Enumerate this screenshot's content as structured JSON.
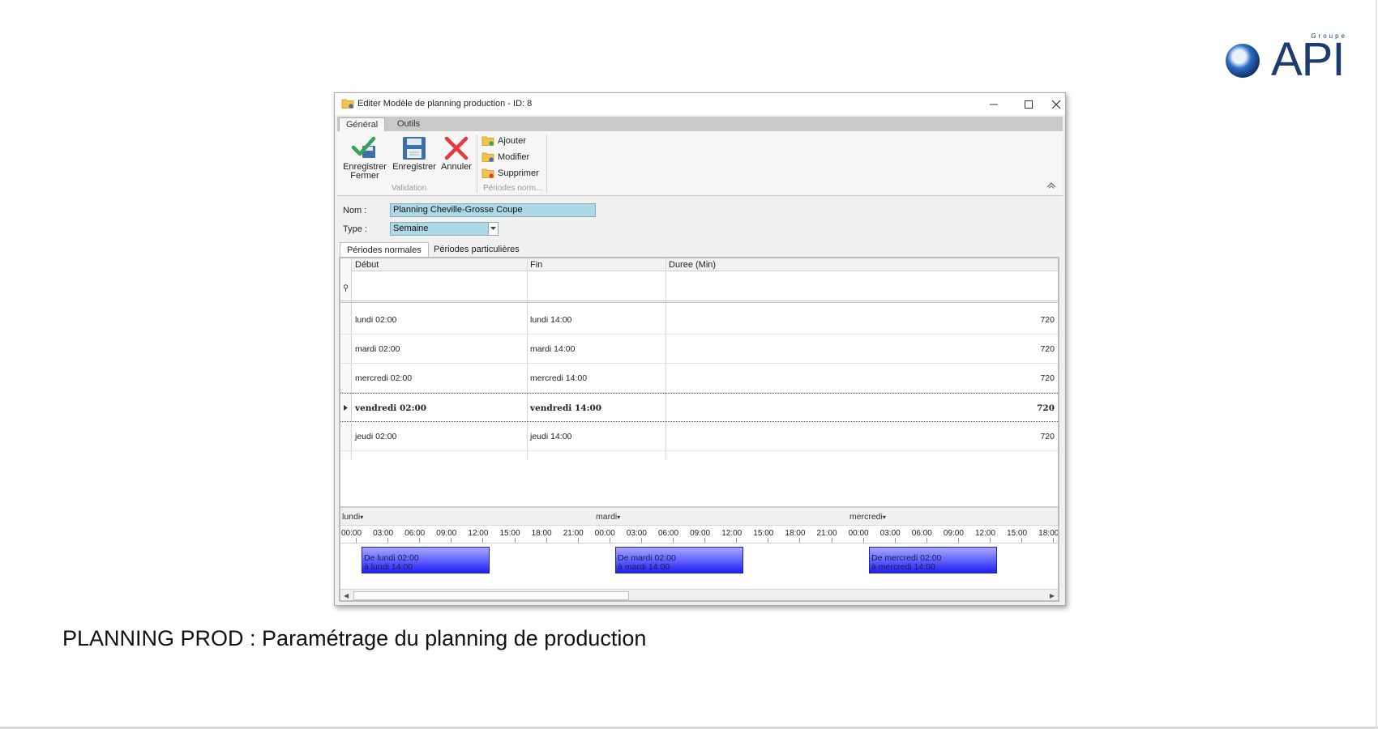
{
  "window": {
    "title": "Editer Modèle de planning production - ID: 8",
    "icons": {
      "title": "folder-edit-icon",
      "minimize": "minimize-icon",
      "maximize": "maximize-icon",
      "close": "close-icon"
    }
  },
  "ribbon": {
    "tabs": [
      {
        "label": "Général",
        "active": true
      },
      {
        "label": "Outils",
        "active": false
      }
    ],
    "validation_group": {
      "label": "Validation",
      "buttons": [
        {
          "line1": "Enregistrer",
          "line2": "Fermer",
          "icon": "check-save-icon"
        },
        {
          "line1": "Enregistrer",
          "line2": "",
          "icon": "floppy-disk-icon"
        },
        {
          "line1": "Annuler",
          "line2": "",
          "icon": "red-x-icon"
        }
      ]
    },
    "periodes_group": {
      "label": "Périodes norm...",
      "buttons": [
        {
          "label": "Ajouter",
          "icon": "folder-add-icon"
        },
        {
          "label": "Modifier",
          "icon": "folder-edit-icon"
        },
        {
          "label": "Supprimer",
          "icon": "folder-delete-icon"
        }
      ]
    }
  },
  "form": {
    "nom_label": "Nom :",
    "nom_value": "Planning Cheville-Grosse Coupe",
    "type_label": "Type :",
    "type_value": "Semaine"
  },
  "period_tabs": [
    {
      "label": "Périodes normales",
      "active": true
    },
    {
      "label": "Périodes particulières",
      "active": false
    }
  ],
  "grid": {
    "columns": [
      "Début",
      "Fin",
      "Duree (Min)"
    ],
    "rows": [
      {
        "debut": "lundi 02:00",
        "fin": "lundi 14:00",
        "duree": "720",
        "selected": false
      },
      {
        "debut": "mardi 02:00",
        "fin": "mardi 14:00",
        "duree": "720",
        "selected": false
      },
      {
        "debut": "mercredi 02:00",
        "fin": "mercredi 14:00",
        "duree": "720",
        "selected": false
      },
      {
        "debut": "vendredi 02:00",
        "fin": "vendredi 14:00",
        "duree": "720",
        "selected": true
      },
      {
        "debut": "jeudi 02:00",
        "fin": "jeudi 14:00",
        "duree": "720",
        "selected": false
      }
    ]
  },
  "scheduler": {
    "days": [
      "lundi",
      "mardi",
      "mercredi"
    ],
    "hours": [
      "00:00",
      "03:00",
      "06:00",
      "09:00",
      "12:00",
      "15:00",
      "18:00",
      "21:00",
      "00:00",
      "03:00",
      "06:00",
      "09:00",
      "12:00",
      "15:00",
      "18:00",
      "21:00",
      "00:00",
      "03:00",
      "06:00",
      "09:00",
      "12:00",
      "15:00",
      "18:00"
    ],
    "events": [
      {
        "line1": "De lundi 02:00",
        "line2": "à lundi 14:00"
      },
      {
        "line1": "De mardi 02:00",
        "line2": "à mardi 14:00"
      },
      {
        "line1": "De mercredi 02:00",
        "line2": "à mercredi 14:00"
      }
    ],
    "event_color": "#4a4aff"
  },
  "logo": {
    "group": "Groupe",
    "text": "API"
  },
  "caption": "PLANNING PROD : Paramétrage du planning de production"
}
